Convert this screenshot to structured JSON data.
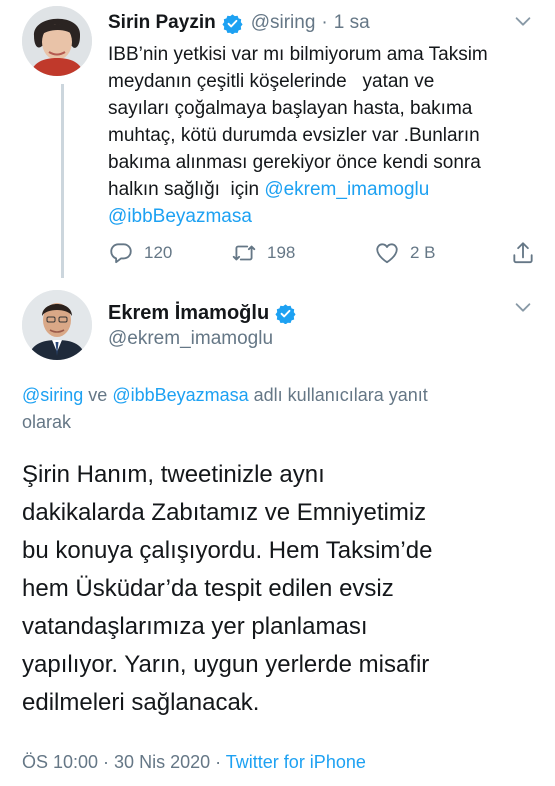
{
  "parent_tweet": {
    "display_name": "Sirin Payzin",
    "handle": "@siring",
    "time": "1 sa",
    "separator": "·",
    "text_lines": [
      "IBB’nin yetkisi var mı bilmiyorum ama Taksim",
      "meydanın çeşitli köşelerinde   yatan ve",
      "sayıları çoğalmaya başlayan hasta, bakıma",
      "muhtaç, kötü durumda evsizler var .Bunların",
      "bakıma alınması gerekiyor önce kendi sonra",
      "halkın sağlığı  için "
    ],
    "mention_1": "@ekrem_imamoglu",
    "mention_2": "@ibbBeyazmasa",
    "replies": "120",
    "retweets": "198",
    "likes": "2 B"
  },
  "main_tweet": {
    "display_name": "Ekrem İmamoğlu",
    "handle": "@ekrem_imamoglu",
    "reply_to": {
      "mention_1": "@siring",
      "connector": " ve ",
      "mention_2": "@ibbBeyazmasa",
      "suffix_line1": " adlı kullanıcılara yanıt",
      "suffix_line2": "olarak"
    },
    "text_lines": [
      "Şirin Hanım, tweetinizle aynı",
      "dakikalarda Zabıtamız ve Emniyetimiz",
      "bu konuya çalışıyordu. Hem Taksim’de",
      "hem Üsküdar’da tespit edilen evsiz",
      "vatandaşlarımıza yer planlaması",
      "yapılıyor. Yarın, uygun yerlerde misafir",
      "edilmeleri sağlanacak."
    ],
    "timestamp": "ÖS 10:00 · 30 Nis 2020",
    "separator": " · ",
    "source": "Twitter for iPhone"
  },
  "icons": {
    "verified": "verified-badge-icon",
    "chevron": "chevron-down-icon",
    "reply": "reply-icon",
    "retweet": "retweet-icon",
    "like": "heart-icon",
    "share": "share-icon"
  },
  "colors": {
    "link": "#1da1f2",
    "muted": "#657786",
    "text": "#14171a",
    "thread_line": "#ccd6dd"
  }
}
